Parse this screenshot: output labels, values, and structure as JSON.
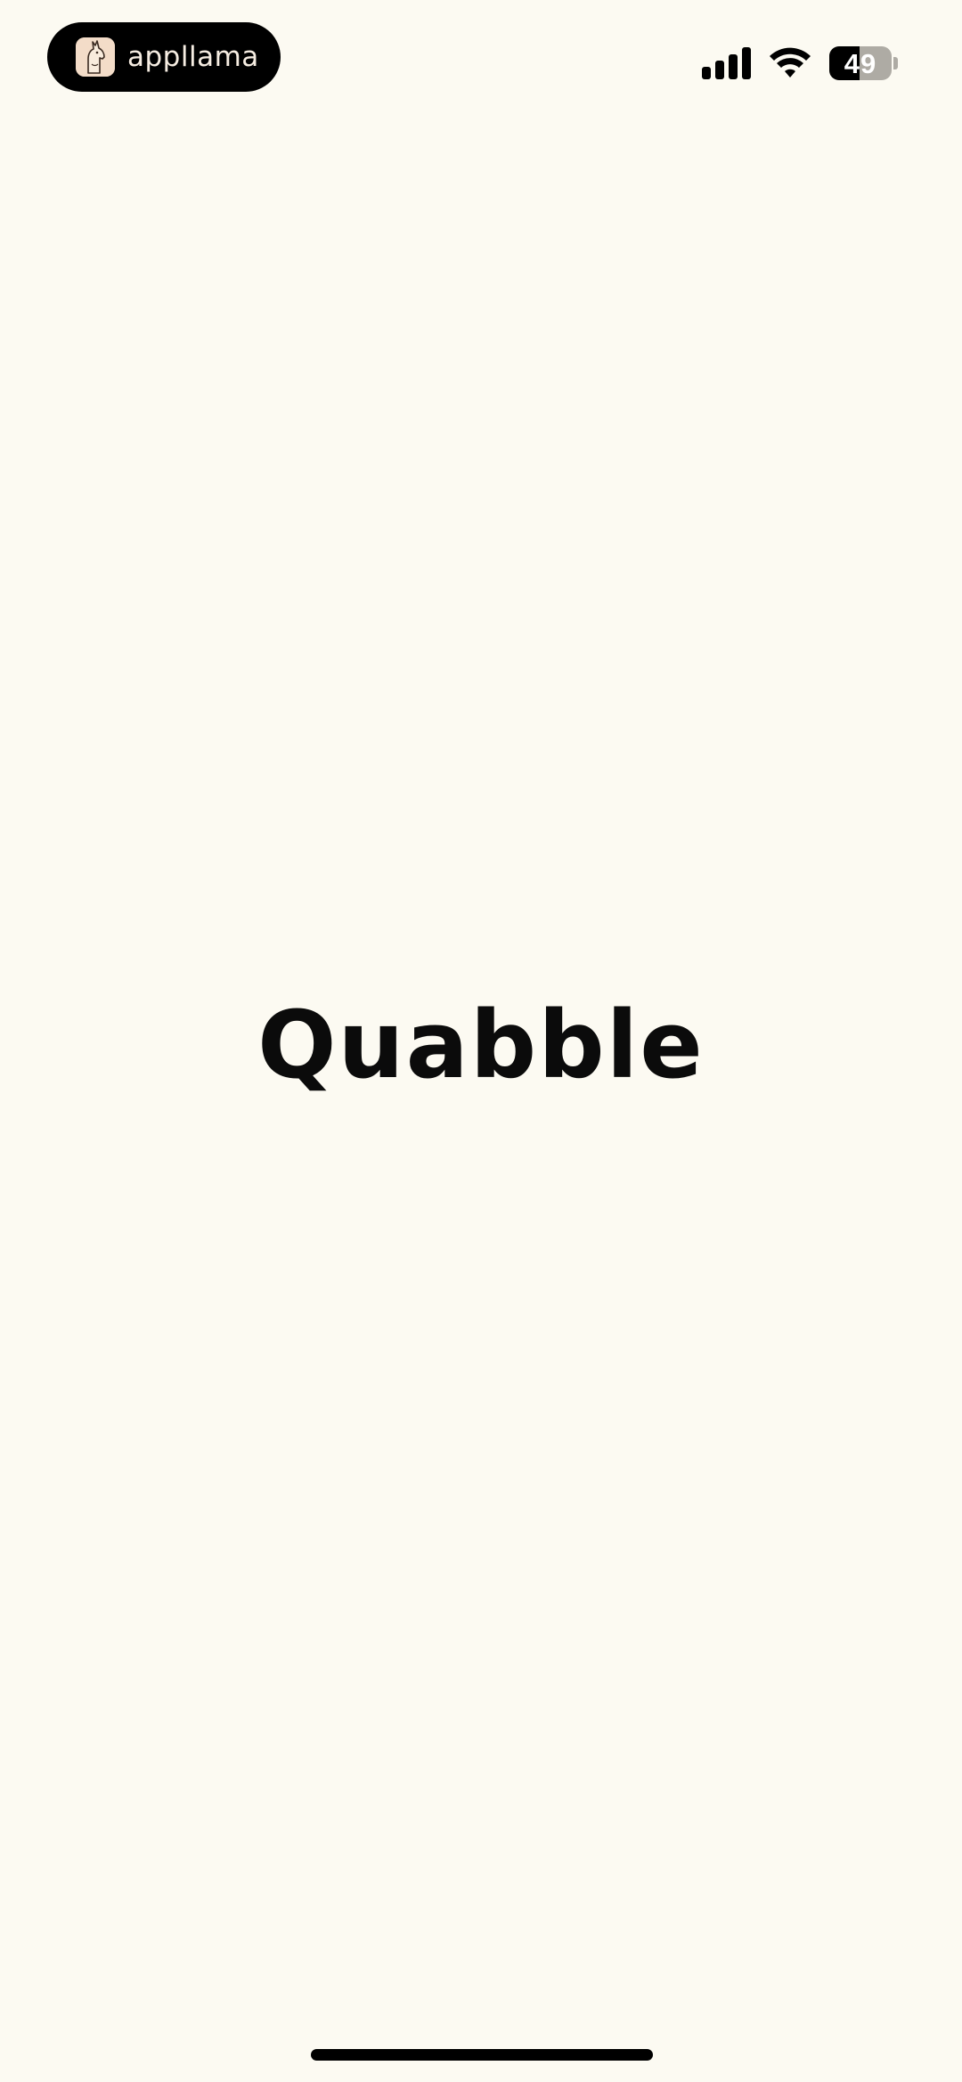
{
  "status_bar": {
    "app_name": "appllama",
    "app_icon": "llama-icon",
    "signal_icon": "cellular-signal-icon",
    "wifi_icon": "wifi-icon",
    "battery_level": "49",
    "battery_fraction": 0.49
  },
  "splash": {
    "logo_text": "Quabble"
  },
  "colors": {
    "background": "#fcfaf2",
    "text": "#0b0b0b",
    "pill": "#000000",
    "battery_empty": "#aeaba4"
  }
}
